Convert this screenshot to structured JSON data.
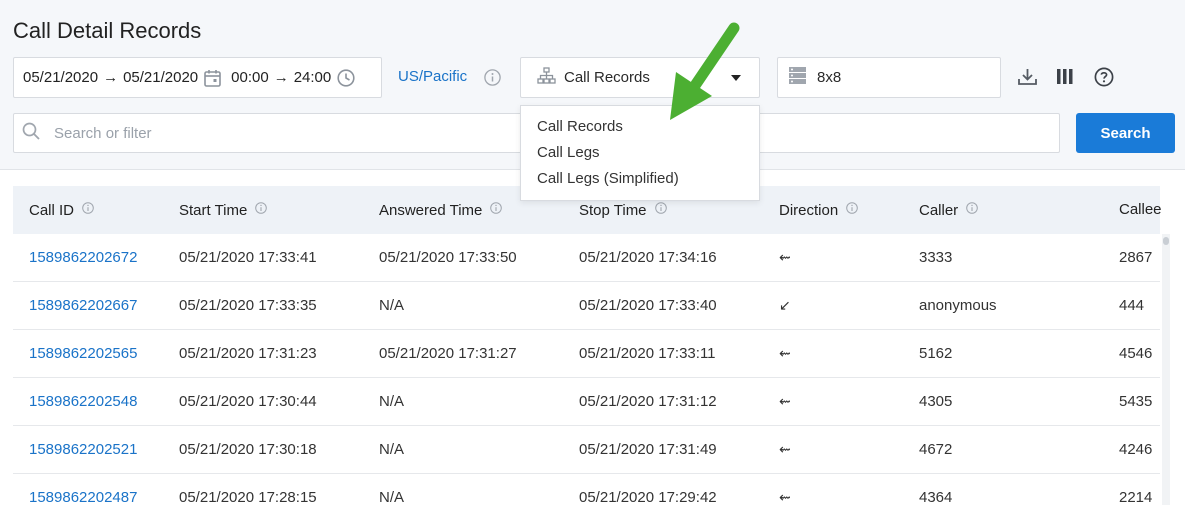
{
  "title": "Call Detail Records",
  "daterange": {
    "start_date": "05/21/2020",
    "end_date": "05/21/2020",
    "start_time": "00:00",
    "end_time": "24:00",
    "arrow": "→"
  },
  "timezone": "US/Pacific",
  "record_type": {
    "selected": "Call Records",
    "options": [
      "Call Records",
      "Call Legs",
      "Call Legs (Simplified)"
    ]
  },
  "server": "8x8",
  "search": {
    "placeholder": "Search or filter",
    "button": "Search"
  },
  "columns": [
    "Call ID",
    "Start Time",
    "Answered Time",
    "Stop Time",
    "Direction",
    "Caller",
    "Callee"
  ],
  "rows": [
    {
      "id": "1589862202672",
      "start": "05/21/2020 17:33:41",
      "answered": "05/21/2020 17:33:50",
      "stop": "05/21/2020 17:34:16",
      "direction": "⇜",
      "caller": "3333",
      "callee": "2867"
    },
    {
      "id": "1589862202667",
      "start": "05/21/2020 17:33:35",
      "answered": "N/A",
      "stop": "05/21/2020 17:33:40",
      "direction": "↙",
      "caller": "anonymous",
      "callee": "444"
    },
    {
      "id": "1589862202565",
      "start": "05/21/2020 17:31:23",
      "answered": "05/21/2020 17:31:27",
      "stop": "05/21/2020 17:33:11",
      "direction": "⇜",
      "caller": "5162",
      "callee": "4546"
    },
    {
      "id": "1589862202548",
      "start": "05/21/2020 17:30:44",
      "answered": "N/A",
      "stop": "05/21/2020 17:31:12",
      "direction": "⇜",
      "caller": "4305",
      "callee": "5435"
    },
    {
      "id": "1589862202521",
      "start": "05/21/2020 17:30:18",
      "answered": "N/A",
      "stop": "05/21/2020 17:31:49",
      "direction": "⇜",
      "caller": "4672",
      "callee": "4246"
    },
    {
      "id": "1589862202487",
      "start": "05/21/2020 17:28:15",
      "answered": "N/A",
      "stop": "05/21/2020 17:29:42",
      "direction": "⇜",
      "caller": "4364",
      "callee": "2214"
    }
  ],
  "colors": {
    "accent": "#1a7bd8",
    "link": "#1a73c8",
    "annotation_arrow": "#4caf32"
  }
}
